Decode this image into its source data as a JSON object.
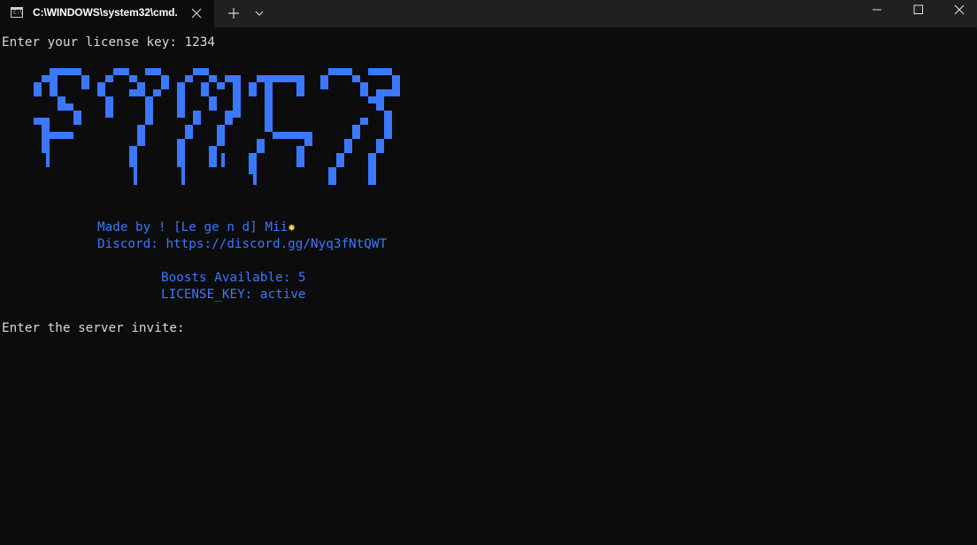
{
  "titlebar": {
    "tab_title": "C:\\WINDOWS\\system32\\cmd.",
    "tab_icon_text": "C:\\"
  },
  "console": {
    "prompt_license": "Enter your license key: 1234",
    "made_by": "Made by ! [Le ge n d] Mii",
    "discord": "Discord: https://discord.gg/Nyq3fNtQWT",
    "boosts": "Boosts Available: 5",
    "license_status": "LICENSE_KEY: active",
    "prompt_invite": "Enter the server invite:"
  },
  "colors": {
    "terminal_bg": "#0c0c0c",
    "titlebar_bg": "#202020",
    "text_white": "#d8d8d8",
    "text_blue": "#3b78ff",
    "sun_emoji": "#ffd23f"
  },
  "icons": [
    "cmd-icon",
    "close-icon",
    "plus-icon",
    "chevron-down-icon",
    "minimize-icon",
    "maximize-icon",
    "window-close-icon"
  ]
}
